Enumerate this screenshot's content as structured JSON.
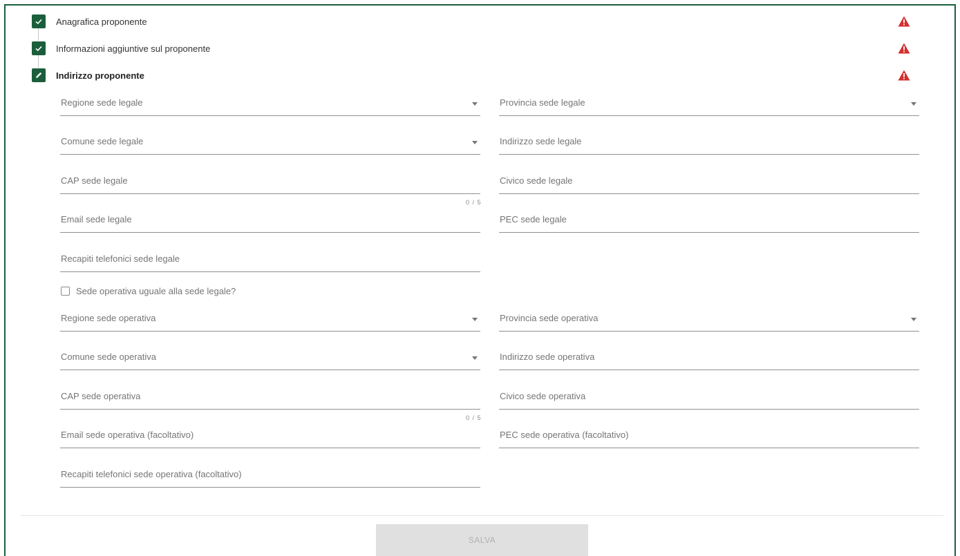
{
  "steps": [
    {
      "label": "Anagrafica proponente",
      "status": "done",
      "icon": "check-icon",
      "warning": true
    },
    {
      "label": "Informazioni aggiuntive sul proponente",
      "status": "done",
      "icon": "check-icon",
      "warning": true
    },
    {
      "label": "Indirizzo proponente",
      "status": "editing",
      "icon": "pencil-icon",
      "warning": true
    }
  ],
  "legale": {
    "regione": {
      "label": "Regione sede legale",
      "type": "select",
      "value": ""
    },
    "provincia": {
      "label": "Provincia sede legale",
      "type": "select",
      "value": ""
    },
    "comune": {
      "label": "Comune sede legale",
      "type": "select",
      "value": ""
    },
    "indirizzo": {
      "label": "Indirizzo sede legale",
      "type": "text",
      "value": ""
    },
    "cap": {
      "label": "CAP sede legale",
      "type": "text",
      "value": "",
      "counter": "0 / 5"
    },
    "civico": {
      "label": "Civico sede legale",
      "type": "text",
      "value": ""
    },
    "email": {
      "label": "Email sede legale",
      "type": "text",
      "value": ""
    },
    "pec": {
      "label": "PEC sede legale",
      "type": "text",
      "value": ""
    },
    "telefono": {
      "label": "Recapiti telefonici sede legale",
      "type": "text",
      "value": ""
    }
  },
  "same_as_legale": {
    "label": "Sede operativa uguale alla sede legale?",
    "checked": false
  },
  "operativa": {
    "regione": {
      "label": "Regione sede operativa",
      "type": "select",
      "value": ""
    },
    "provincia": {
      "label": "Provincia sede operativa",
      "type": "select",
      "value": ""
    },
    "comune": {
      "label": "Comune sede operativa",
      "type": "select",
      "value": ""
    },
    "indirizzo": {
      "label": "Indirizzo sede operativa",
      "type": "text",
      "value": ""
    },
    "cap": {
      "label": "CAP sede operativa",
      "type": "text",
      "value": "",
      "counter": "0 / 5"
    },
    "civico": {
      "label": "Civico sede operativa",
      "type": "text",
      "value": ""
    },
    "email": {
      "label": "Email sede operativa (facoltativo)",
      "type": "text",
      "value": ""
    },
    "pec": {
      "label": "PEC sede operativa (facoltativo)",
      "type": "text",
      "value": ""
    },
    "telefono": {
      "label": "Recapiti telefonici sede operativa (facoltativo)",
      "type": "text",
      "value": ""
    }
  },
  "save_label": "SALVA",
  "colors": {
    "accent": "#1b5e3b",
    "warning": "#d32f2f",
    "disabled_bg": "#e0e0e0",
    "disabled_text": "#b0b0b0"
  }
}
